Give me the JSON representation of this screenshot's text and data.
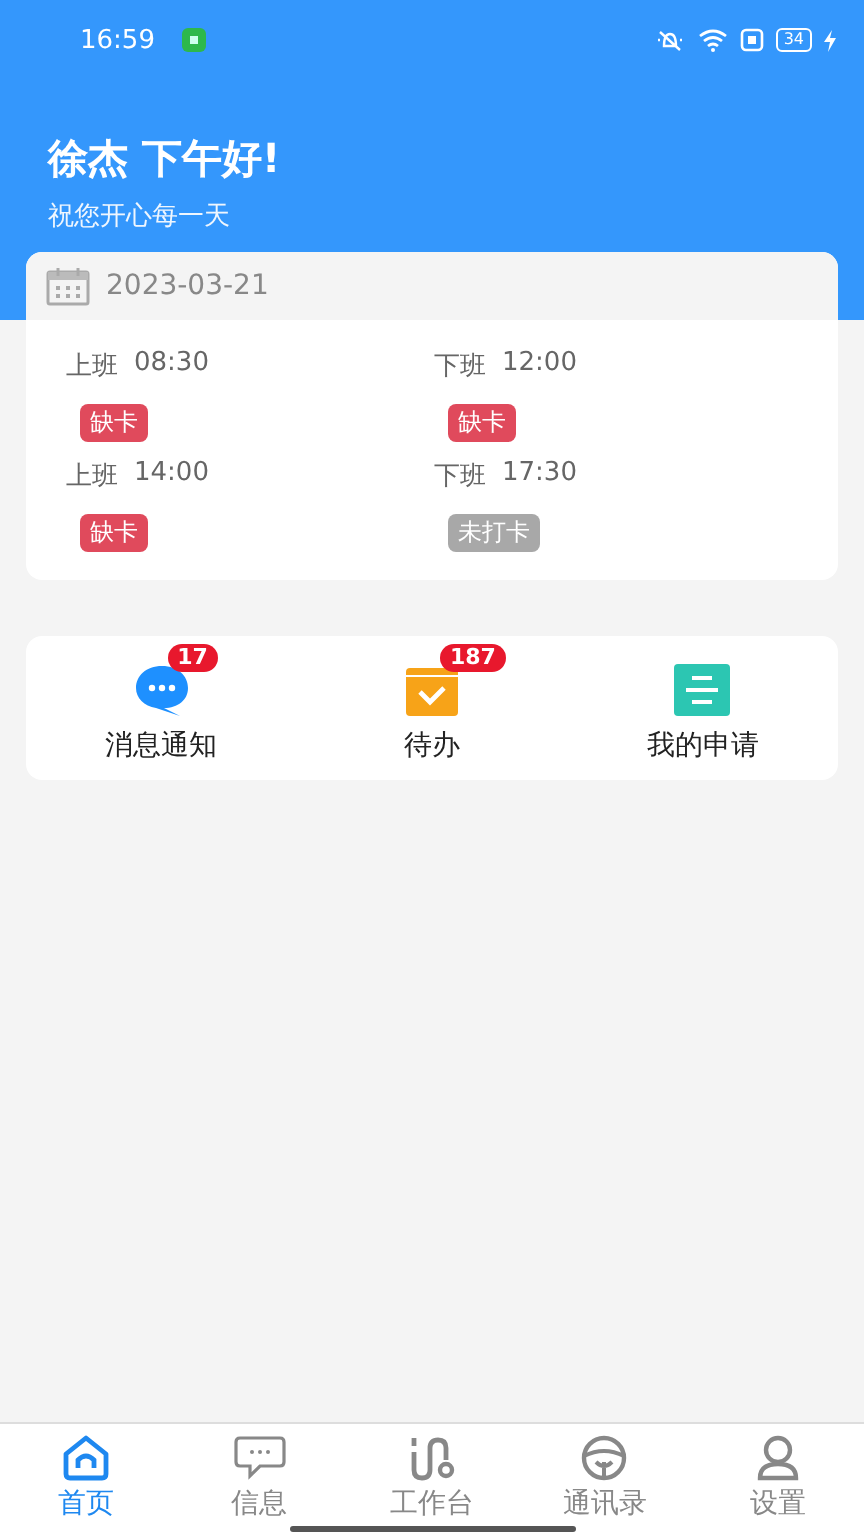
{
  "status_bar": {
    "time": "16:59",
    "battery": "34"
  },
  "greeting": {
    "title": "徐杰 下午好!",
    "subtitle": "祝您开心每一天"
  },
  "attendance": {
    "date": "2023-03-21",
    "records": [
      {
        "label": "上班",
        "time": "08:30",
        "status": {
          "text": "缺卡",
          "kind": "missing"
        }
      },
      {
        "label": "下班",
        "time": "12:00",
        "status": {
          "text": "缺卡",
          "kind": "missing"
        }
      },
      {
        "label": "上班",
        "time": "14:00",
        "status": {
          "text": "缺卡",
          "kind": "missing"
        }
      },
      {
        "label": "下班",
        "time": "17:30",
        "status": {
          "text": "未打卡",
          "kind": "pending"
        }
      }
    ]
  },
  "shortcuts": [
    {
      "kind": "message",
      "label": "消息通知",
      "badge": "17"
    },
    {
      "kind": "todo",
      "label": "待办",
      "badge": "187"
    },
    {
      "kind": "application",
      "label": "我的申请"
    }
  ],
  "tab_bar": [
    {
      "kind": "home",
      "label": "首页",
      "selected": true
    },
    {
      "kind": "info",
      "label": "信息",
      "selected": false
    },
    {
      "kind": "workbench",
      "label": "工作台",
      "selected": false
    },
    {
      "kind": "contacts",
      "label": "通讯录",
      "selected": false
    },
    {
      "kind": "settings",
      "label": "设置",
      "selected": false
    }
  ]
}
